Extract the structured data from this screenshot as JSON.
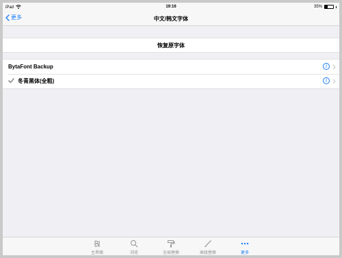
{
  "status": {
    "device": "iPad",
    "time": "19:16",
    "battery": "35%",
    "battery_level": 0.35
  },
  "nav": {
    "back_label": "更多",
    "title": "中文/韩文字体"
  },
  "restore": {
    "label": "恢复原字体"
  },
  "fonts": [
    {
      "name": "BytaFont Backup",
      "checked": false
    },
    {
      "name": "冬青黑体(全粗)",
      "checked": true
    }
  ],
  "tabs": [
    {
      "label": "主界面",
      "icon": "bytafont-logo-icon",
      "active": false
    },
    {
      "label": "浏览",
      "icon": "search-icon",
      "active": false
    },
    {
      "label": "全局替换",
      "icon": "paint-roller-icon",
      "active": false
    },
    {
      "label": "高级替换",
      "icon": "brush-icon",
      "active": false
    },
    {
      "label": "更多",
      "icon": "more-dots-icon",
      "active": true
    }
  ],
  "colors": {
    "accent": "#1a7cf5",
    "background": "#efeff4",
    "tab_inactive": "#929292"
  }
}
